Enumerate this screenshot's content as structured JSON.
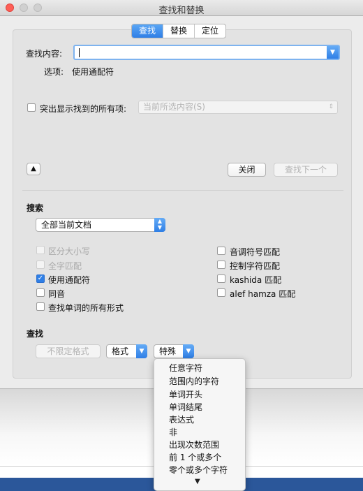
{
  "window": {
    "title": "查找和替换"
  },
  "tabs": [
    {
      "label": "查找",
      "active": true
    },
    {
      "label": "替换",
      "active": false
    },
    {
      "label": "定位",
      "active": false
    }
  ],
  "find": {
    "label": "查找内容:",
    "value": "",
    "options_label": "选项:",
    "options_value": "使用通配符"
  },
  "highlight": {
    "label": "突出显示找到的所有项:",
    "checked": false,
    "select_value": "当前所选内容(S)"
  },
  "buttons": {
    "close": "关闭",
    "find_next": "查找下一个",
    "no_format": "不限定格式",
    "format": "格式",
    "special": "特殊"
  },
  "search": {
    "heading": "搜索",
    "scope": "全部当前文档",
    "options_left": [
      {
        "label": "区分大小写",
        "checked": false,
        "enabled": false
      },
      {
        "label": "全字匹配",
        "checked": false,
        "enabled": false
      },
      {
        "label": "使用通配符",
        "checked": true,
        "enabled": true
      },
      {
        "label": "同音",
        "checked": false,
        "enabled": true
      },
      {
        "label": "查找单词的所有形式",
        "checked": false,
        "enabled": true
      }
    ],
    "options_right": [
      {
        "label": "音调符号匹配",
        "checked": false,
        "enabled": true
      },
      {
        "label": "控制字符匹配",
        "checked": false,
        "enabled": true
      },
      {
        "label": "kashida 匹配",
        "checked": false,
        "enabled": true
      },
      {
        "label": "alef hamza 匹配",
        "checked": false,
        "enabled": true
      }
    ]
  },
  "find_section": {
    "heading": "查找"
  },
  "special_menu": {
    "items": [
      "任意字符",
      "范围内的字符",
      "单词开头",
      "单词结尾",
      "表达式",
      "非",
      "出现次数范围",
      "前 1 个或多个",
      "零个或多个字符"
    ],
    "more_indicator": "▼"
  },
  "colors": {
    "accent": "#2f7fe6",
    "ribbon": "#2b579a",
    "close": "#fe5f57",
    "disabled_light": "#cfcfcf"
  }
}
